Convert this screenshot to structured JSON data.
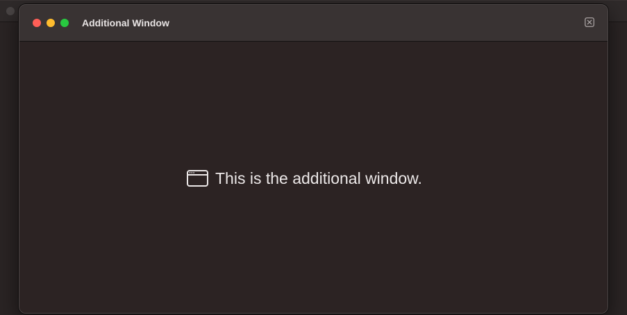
{
  "window": {
    "title": "Additional Window",
    "message": "This is the additional window."
  },
  "icons": {
    "close_button": "close-square-icon",
    "message_icon": "app-window-icon"
  },
  "colors": {
    "traffic_close": "#ff5f57",
    "traffic_minimize": "#febc2e",
    "traffic_zoom": "#28c840",
    "window_background": "#2c2323",
    "titlebar_background": "#393333"
  }
}
